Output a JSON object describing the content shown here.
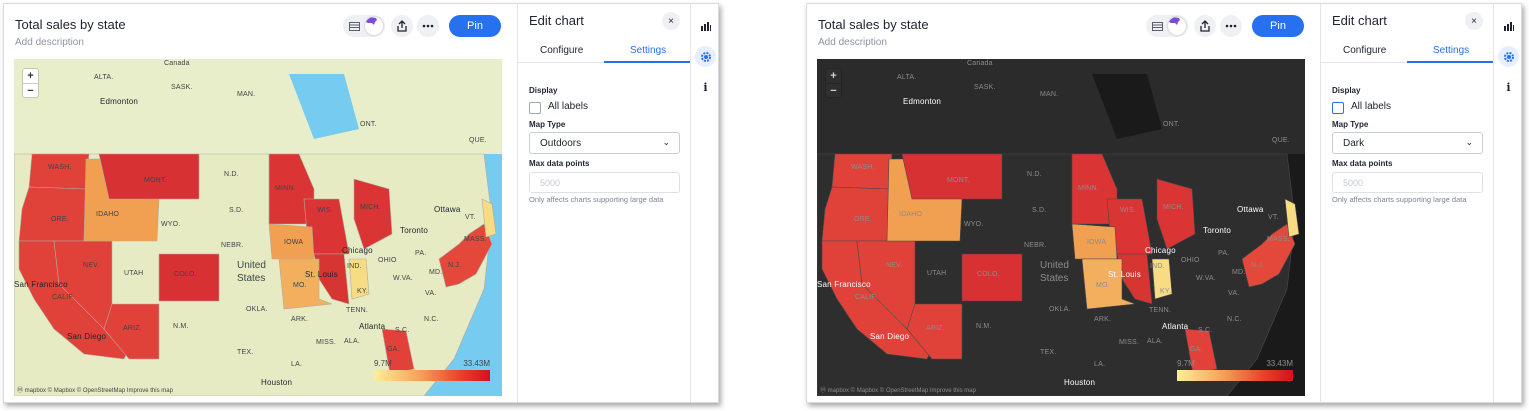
{
  "panels": [
    {
      "chart": {
        "title": "Total sales by state",
        "description": "Add description",
        "pin_label": "Pin",
        "zoom_in": "+",
        "zoom_out": "−",
        "legend": {
          "min": "9.7M",
          "max": "33.43M"
        },
        "attribution": "Ⓜ mapbox © Mapbox © OpenStreetMap Improve this map",
        "map_labels": [
          "Canada",
          "ALTA.",
          "SASK.",
          "MAN.",
          "Edmonton",
          "ONT.",
          "QUE.",
          "WASH.",
          "MONT.",
          "N.D.",
          "MINN.",
          "ORE.",
          "IDAHO",
          "WYO.",
          "S.D.",
          "WIS.",
          "MICH.",
          "Ottawa",
          "VT.",
          "Toronto",
          "MASS.",
          "NEBR.",
          "IOWA",
          "Chicago",
          "PA.",
          "NEV.",
          "UTAH",
          "COLO.",
          "United",
          "States",
          "IND.",
          "OHIO",
          "MD.",
          "N.J.",
          "San Francisco",
          "St. Louis",
          "W.VA.",
          "CALIF.",
          "MO.",
          "KY.",
          "VA.",
          "OKLA.",
          "ARK.",
          "TENN.",
          "N.C.",
          "ARIZ.",
          "N.M.",
          "San Diego",
          "Atlanta",
          "S.C.",
          "MISS.",
          "ALA.",
          "GA.",
          "TEX.",
          "LA.",
          "Houston"
        ]
      },
      "editor": {
        "title": "Edit chart",
        "close": "×",
        "tabs": [
          "Configure",
          "Settings"
        ],
        "display_label": "Display",
        "all_labels": "All labels",
        "map_type_label": "Map Type",
        "map_type_value": "Outdoors",
        "max_points_label": "Max data points",
        "max_points_placeholder": "5000",
        "hint": "Only affects charts supporting large data"
      }
    },
    {
      "chart": {
        "title": "Total sales by state",
        "description": "Add description",
        "pin_label": "Pin",
        "zoom_in": "+",
        "zoom_out": "−",
        "legend": {
          "min": "9.7M",
          "max": "33.43M"
        },
        "attribution": "Ⓜ mapbox © Mapbox © OpenStreetMap Improve this map",
        "map_labels": [
          "Canada",
          "ALTA.",
          "SASK.",
          "MAN.",
          "Edmonton",
          "ONT.",
          "QUE.",
          "WASH.",
          "MONT.",
          "N.D.",
          "MINN.",
          "ORE.",
          "IDAHO",
          "WYO.",
          "S.D.",
          "WIS.",
          "MICH.",
          "Ottawa",
          "VT.",
          "Toronto",
          "MASS.",
          "NEBR.",
          "IOWA",
          "Chicago",
          "PA.",
          "NEV.",
          "UTAH",
          "COLO.",
          "United",
          "States",
          "IND.",
          "OHIO",
          "MD.",
          "N.J.",
          "San Francisco",
          "St. Louis",
          "W.VA.",
          "CALIF.",
          "MO.",
          "KY.",
          "VA.",
          "OKLA.",
          "ARK.",
          "TENN.",
          "N.C.",
          "ARIZ.",
          "N.M.",
          "San Diego",
          "Atlanta",
          "S.C.",
          "MISS.",
          "ALA.",
          "GA.",
          "TEX.",
          "LA.",
          "Houston"
        ]
      },
      "editor": {
        "title": "Edit chart",
        "close": "×",
        "tabs": [
          "Configure",
          "Settings"
        ],
        "display_label": "Display",
        "all_labels": "All labels",
        "map_type_label": "Map Type",
        "map_type_value": "Dark",
        "max_points_label": "Max data points",
        "max_points_placeholder": "5000",
        "hint": "Only affects charts supporting large data"
      }
    }
  ],
  "themes": {
    "outdoors": {
      "land": "#e8eec9",
      "water": "#76cbf0",
      "unshaded": "#e6ebc4",
      "border": "#b7a8a0",
      "label": "#3f4548",
      "zoom_bg": "#ffffff",
      "zoom_fg": "#333333"
    },
    "dark": {
      "land": "#2b2b2b",
      "water": "#1a1a1a",
      "unshaded": "#2e2e2e",
      "border": "#4a4a4a",
      "label": "#8c8c8c",
      "zoom_bg": "#2e2e2e",
      "zoom_fg": "#d0d0d0"
    }
  },
  "state_colors": {
    "CA": "#e0423a",
    "NV": "#e0423a",
    "AZ": "#e0423a",
    "OR": "#e0423a",
    "WA": "#e0423a",
    "MT": "#d73133",
    "ID": "#f0a050",
    "CO": "#d73133",
    "MN": "#da3534",
    "WI": "#da3534",
    "MI": "#da3534",
    "IA": "#f0a050",
    "MO": "#f2b05e",
    "IL": "#d63532",
    "IN": "#f7dc84",
    "GA": "#e2413a",
    "NE_coast": "#e3483a",
    "ME": "#f7dc84"
  }
}
